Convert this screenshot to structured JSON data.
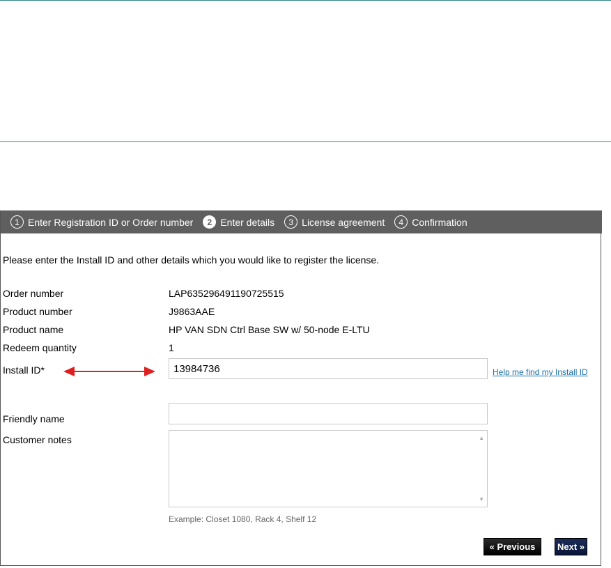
{
  "steps": [
    {
      "num": "1",
      "label": "Enter Registration ID or Order number",
      "active": false
    },
    {
      "num": "2",
      "label": "Enter details",
      "active": true
    },
    {
      "num": "3",
      "label": "License agreement",
      "active": false
    },
    {
      "num": "4",
      "label": "Confirmation",
      "active": false
    }
  ],
  "instructions": "Please enter the Install ID and other details which you would like to register the license.",
  "fields": {
    "order_number": {
      "label": "Order number",
      "value": "LAP635296491190725515"
    },
    "product_number": {
      "label": "Product number",
      "value": "J9863AAE"
    },
    "product_name": {
      "label": "Product name",
      "value": "HP VAN SDN Ctrl Base SW w/ 50-node E-LTU"
    },
    "redeem_quantity": {
      "label": "Redeem quantity",
      "value": "1"
    },
    "install_id": {
      "label": "Install ID*",
      "value": "13984736"
    },
    "friendly_name": {
      "label": "Friendly name",
      "value": ""
    },
    "customer_notes": {
      "label": "Customer notes",
      "value": ""
    }
  },
  "help_link": "Help me find my Install ID",
  "example_text": "Example: Closet 1080, Rack 4, Shelf 12",
  "buttons": {
    "previous": "« Previous",
    "next": "Next »"
  },
  "colors": {
    "stepbar_bg": "#5f5f5f",
    "link": "#1a6fa3",
    "annotation_arrow": "#e02020",
    "next_button": "#1c2c5a"
  }
}
